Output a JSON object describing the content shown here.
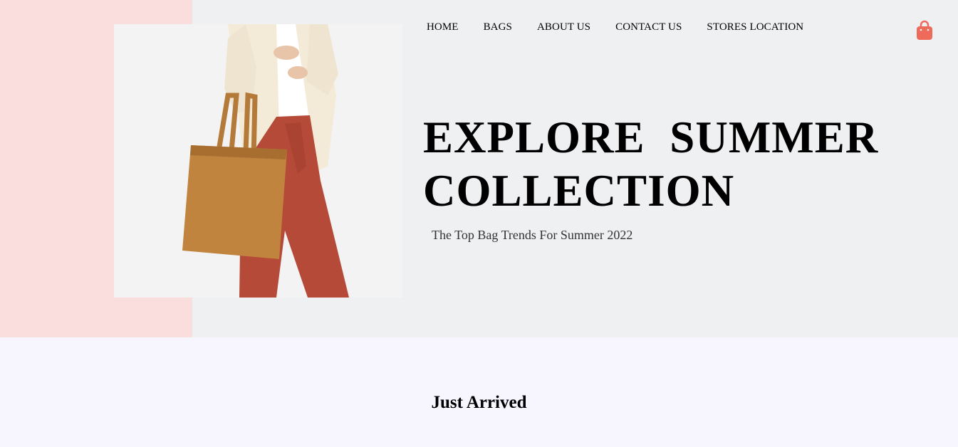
{
  "nav": {
    "items": [
      {
        "label": "HOME"
      },
      {
        "label": "BAGS"
      },
      {
        "label": "ABOUT US"
      },
      {
        "label": "CONTACT US"
      },
      {
        "label": "STORES LOCATION"
      }
    ],
    "cart_icon": "shopping-bag-icon",
    "cart_color": "#ee6b5c"
  },
  "hero": {
    "title": "EXPLORE SUMMER COLLECTION",
    "subtitle": "The Top Bag Trends For Summer 2022",
    "image": "woman-holding-tan-tote-bag",
    "accent_color": "#fadedd",
    "background_color": "#eff0f2"
  },
  "section": {
    "title": "Just Arrived"
  }
}
